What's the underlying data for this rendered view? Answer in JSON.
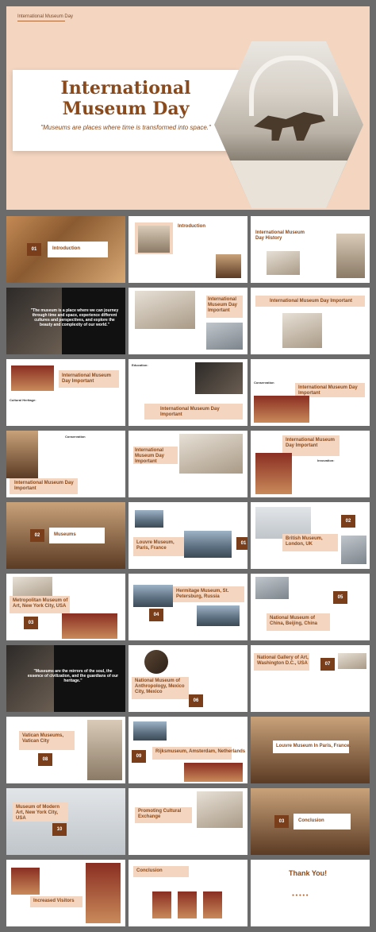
{
  "hero": {
    "tag": "International Museum Day",
    "title_line1": "International",
    "title_line2": "Museum Day",
    "subtitle": "\"Museums are places where time is transformed into space.\""
  },
  "slides": [
    {
      "label": "Introduction",
      "num": "01"
    },
    {
      "label": "Introduction"
    },
    {
      "label": "International Museum Day History"
    },
    {
      "quote": "\"The museum is a place where we can journey through time and space, experience different cultures and perspectives, and explore the beauty and complexity of our world.\""
    },
    {
      "label": "International Museum Day Important"
    },
    {
      "label": "International Museum Day Important"
    },
    {
      "label": "International Museum Day Important",
      "sub": "Cultural Heritage:"
    },
    {
      "label": "International Museum Day Important",
      "sub": "Education:"
    },
    {
      "label": "International Museum Day Important",
      "sub": "Conservation"
    },
    {
      "label": "International Museum Day Important",
      "sub": "Conservation"
    },
    {
      "label": "International Museum Day Important"
    },
    {
      "label": "International Museum Day Important",
      "sub": "Innovation:"
    },
    {
      "label": "Museums",
      "num": "02"
    },
    {
      "label": "Louvre Museum, Paris, France",
      "num": "01"
    },
    {
      "label": "British Museum, London, UK",
      "num": "02"
    },
    {
      "label": "Metropolitan Museum of Art, New York City, USA",
      "num": "03"
    },
    {
      "label": "Hermitage Museum, St. Petersburg, Russia",
      "num": "04"
    },
    {
      "label": "National Museum of China, Beijing, China",
      "num": "05"
    },
    {
      "quote": "\"Museums are the mirrors of the soul, the essence of civilization, and the guardians of our heritage.\""
    },
    {
      "label": "National Museum of Anthropology, Mexico City, Mexico",
      "num": "06"
    },
    {
      "label": "National Gallery of Art, Washington D.C., USA",
      "num": "07"
    },
    {
      "label": "Vatican Museums, Vatican City",
      "num": "08"
    },
    {
      "label": "Rijksmuseum, Amsterdam, Netherlands",
      "num": "09"
    },
    {
      "label": "Louvre Museum In Paris, France."
    },
    {
      "label": "Museum of Modern Art, New York City, USA",
      "num": "10"
    },
    {
      "label": "Promoting Cultural Exchange"
    },
    {
      "label": "Conclusion",
      "num": "03"
    },
    {
      "label": "Increased Visitors"
    },
    {
      "label": "Conclusion"
    },
    {
      "label": "Thank You!"
    }
  ]
}
